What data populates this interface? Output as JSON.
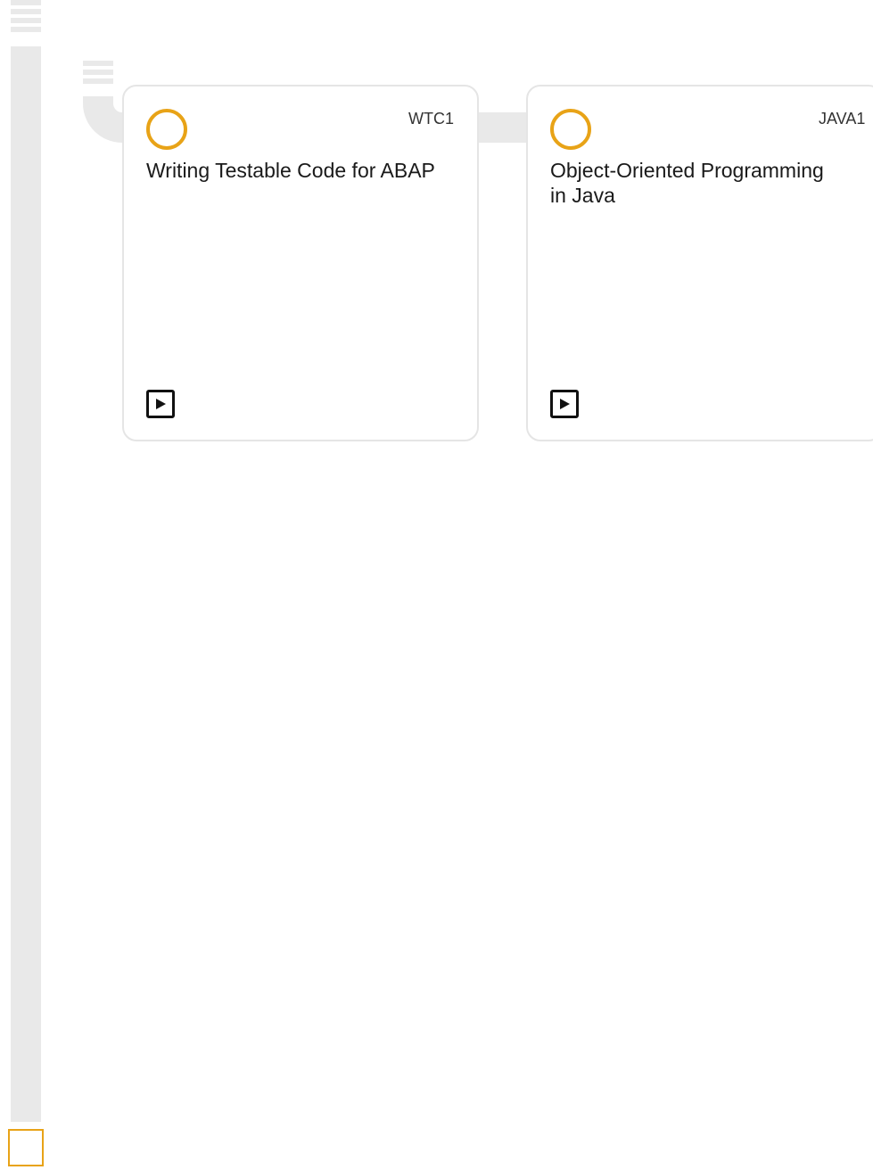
{
  "colors": {
    "accent": "#e8a317",
    "track": "#e9e9e9",
    "card_border": "#e5e5e5"
  },
  "courses": [
    {
      "code": "WTC1",
      "title": "Writing Testable Code for ABAP",
      "status_icon": "status-ring-icon",
      "action_icon": "play-icon"
    },
    {
      "code": "JAVA1",
      "title": "Object-Oriented Programming in Java",
      "status_icon": "status-ring-icon",
      "action_icon": "play-icon"
    }
  ]
}
